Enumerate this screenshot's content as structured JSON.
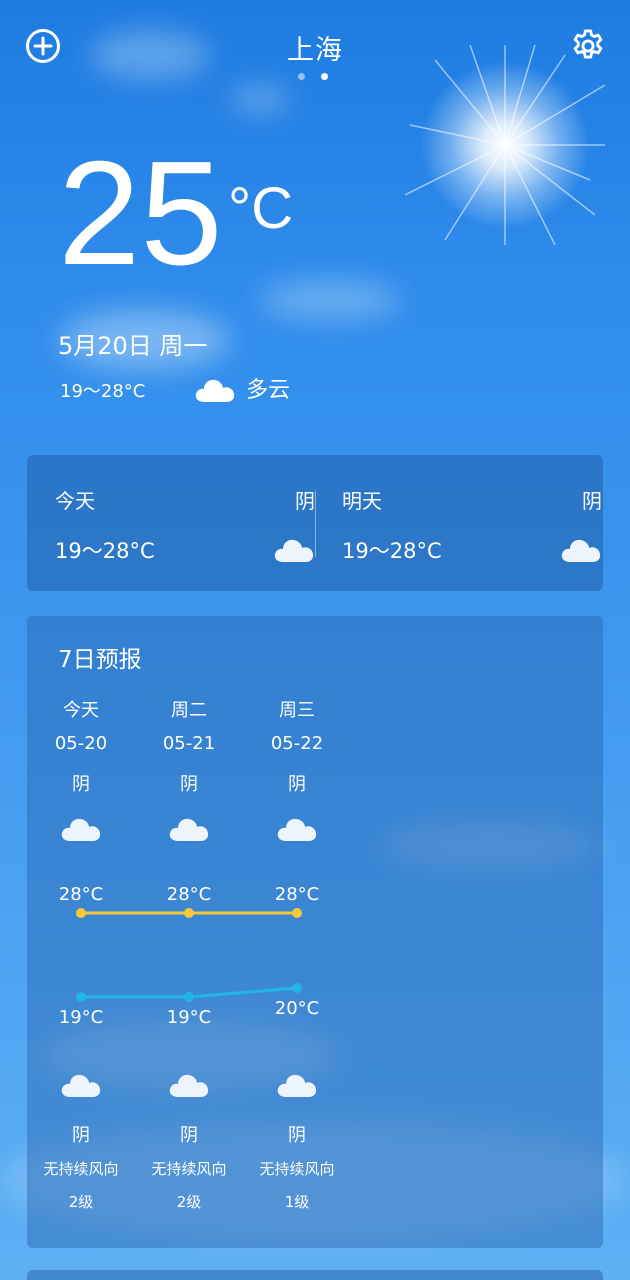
{
  "header": {
    "city": "上海",
    "add_icon": "add-circle-icon",
    "settings_icon": "gear-icon",
    "pages": 2,
    "active_page": 1
  },
  "current": {
    "temperature": "25",
    "unit": "°C",
    "date": "5月20日 周一",
    "range": "19～28°C",
    "condition": "多云",
    "condition_icon": "cloud-icon"
  },
  "today_tomorrow": [
    {
      "label": "今天",
      "condition": "阴",
      "range": "19～28°C",
      "icon": "cloud-icon"
    },
    {
      "label": "明天",
      "condition": "阴",
      "range": "19～28°C",
      "icon": "cloud-icon"
    }
  ],
  "forecast": {
    "title": "7日预报",
    "days": [
      {
        "day": "今天",
        "date": "05-20",
        "cond_day": "阴",
        "high": 28,
        "high_label": "28°C",
        "low": 19,
        "low_label": "19°C",
        "cond_night": "阴",
        "wind": "无持续风向",
        "level": "2级"
      },
      {
        "day": "周二",
        "date": "05-21",
        "cond_day": "阴",
        "high": 28,
        "high_label": "28°C",
        "low": 19,
        "low_label": "19°C",
        "cond_night": "阴",
        "wind": "无持续风向",
        "level": "2级"
      },
      {
        "day": "周三",
        "date": "05-22",
        "cond_day": "阴",
        "high": 28,
        "high_label": "28°C",
        "low": 20,
        "low_label": "20°C",
        "cond_night": "阴",
        "wind": "无持续风向",
        "level": "1级"
      }
    ],
    "colors": {
      "high": "#f5c93b",
      "low": "#1fb6e8"
    }
  }
}
